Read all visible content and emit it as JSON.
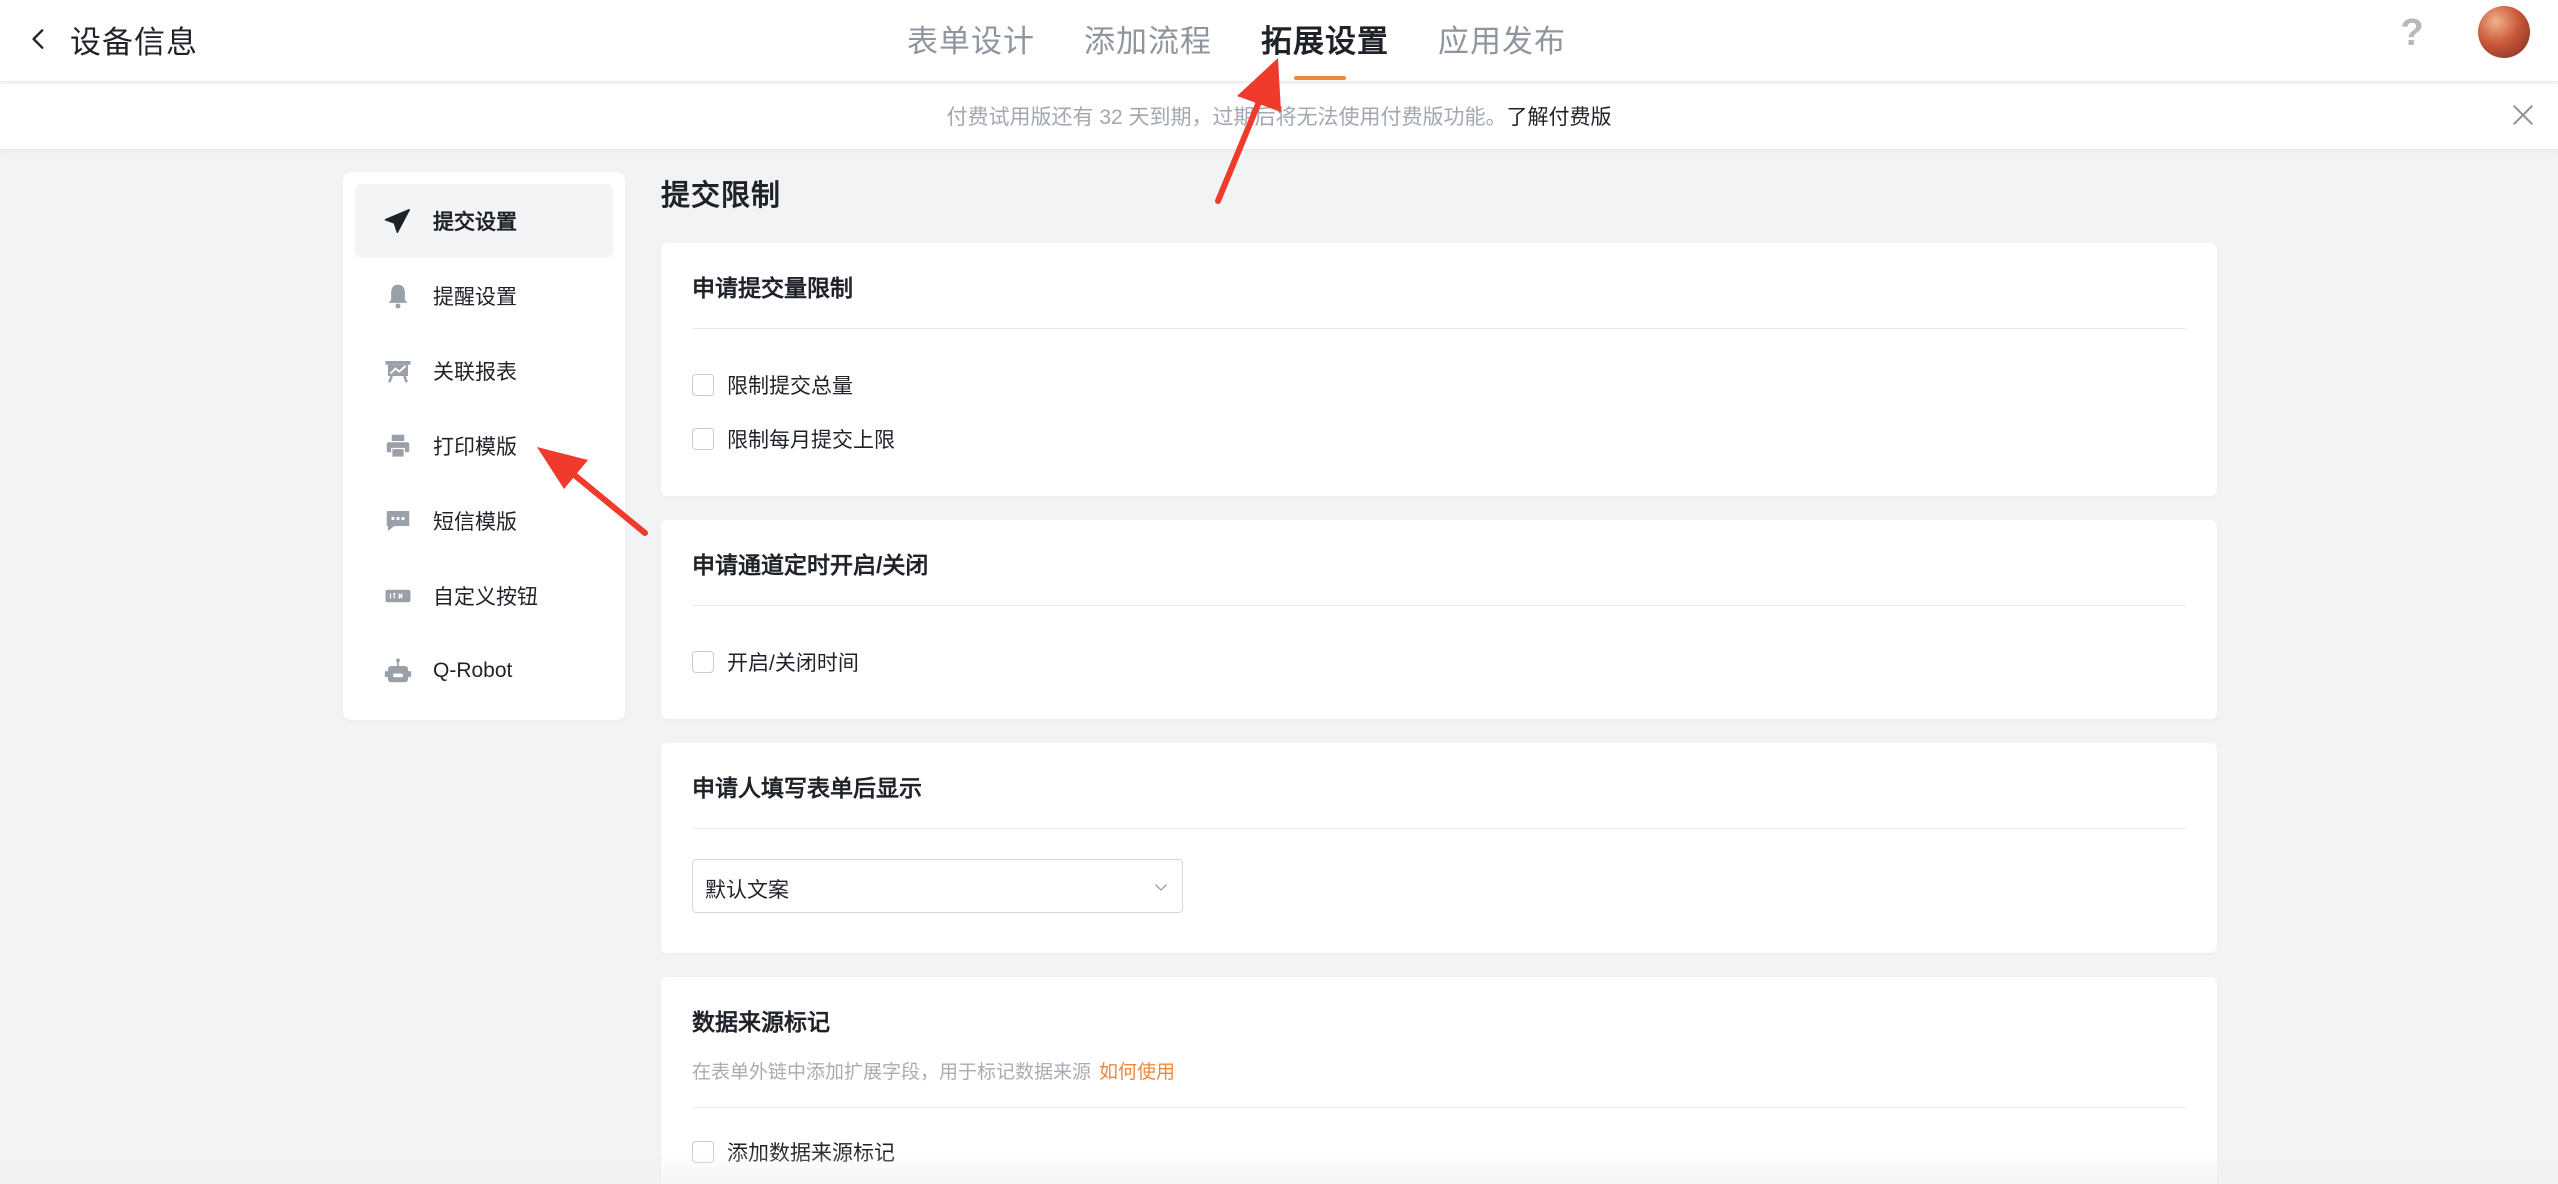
{
  "header": {
    "back_label": "设备信息",
    "tabs": [
      {
        "label": "表单设计",
        "active": false
      },
      {
        "label": "添加流程",
        "active": false
      },
      {
        "label": "拓展设置",
        "active": true
      },
      {
        "label": "应用发布",
        "active": false
      }
    ],
    "help_label": "?",
    "accent_color": "#f0883a"
  },
  "banner": {
    "text": "付费试用版还有 32 天到期，过期后将无法使用付费版功能。",
    "link": "了解付费版"
  },
  "sidebar": {
    "items": [
      {
        "label": "提交设置",
        "icon": "paper-plane-icon",
        "active": true
      },
      {
        "label": "提醒设置",
        "icon": "bell-icon",
        "active": false
      },
      {
        "label": "关联报表",
        "icon": "report-board-icon",
        "active": false
      },
      {
        "label": "打印模版",
        "icon": "printer-icon",
        "active": false
      },
      {
        "label": "短信模版",
        "icon": "sms-message-icon",
        "active": false
      },
      {
        "label": "自定义按钮",
        "icon": "btn-tag-icon",
        "active": false
      },
      {
        "label": "Q-Robot",
        "icon": "robot-icon",
        "active": false
      }
    ]
  },
  "main": {
    "title": "提交限制",
    "cards": [
      {
        "title": "申请提交量限制",
        "options": [
          "限制提交总量",
          "限制每月提交上限"
        ]
      },
      {
        "title": "申请通道定时开启/关闭",
        "options": [
          "开启/关闭时间"
        ]
      },
      {
        "title": "申请人填写表单后显示",
        "select_value": "默认文案"
      },
      {
        "title": "数据来源标记",
        "desc": "在表单外链中添加扩展字段，用于标记数据来源",
        "desc_link": "如何使用",
        "options": [
          "添加数据来源标记"
        ]
      }
    ]
  },
  "annotation_color": "#ef3a2c"
}
